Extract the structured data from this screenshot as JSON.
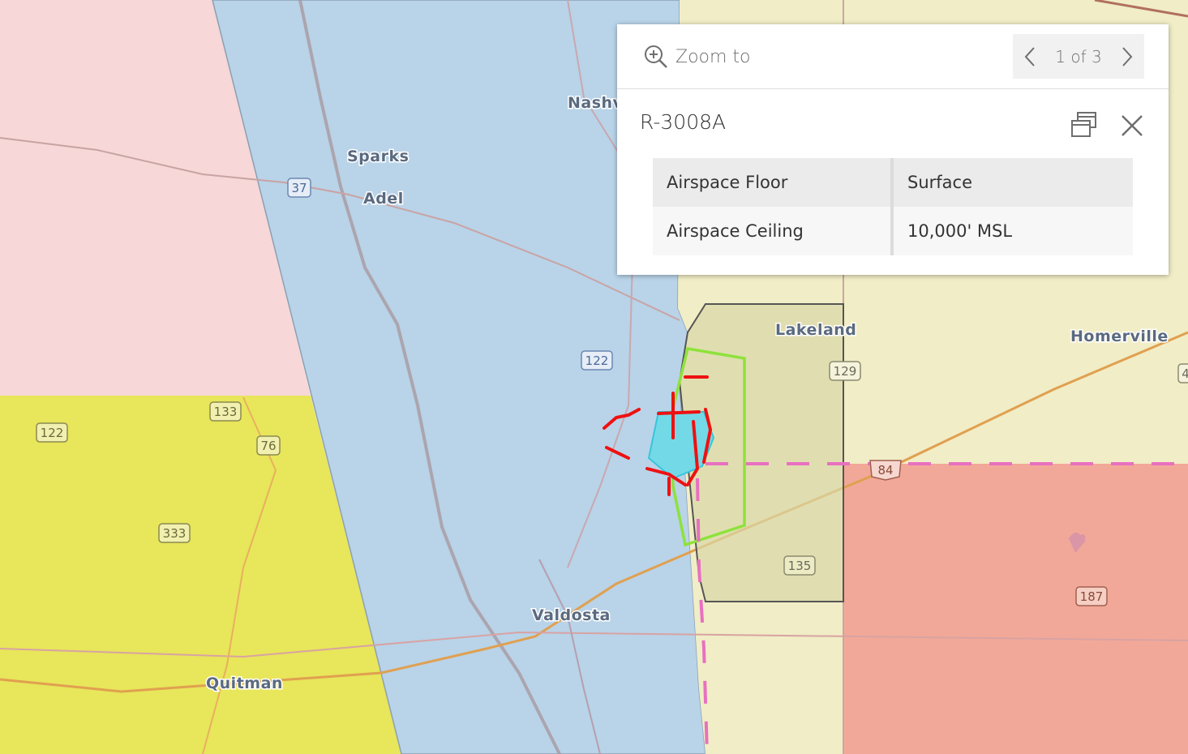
{
  "map": {
    "places": [
      {
        "id": "nashville",
        "label": "Nashv"
      },
      {
        "id": "sparks",
        "label": "Sparks"
      },
      {
        "id": "adel",
        "label": "Adel"
      },
      {
        "id": "lakeland",
        "label": "Lakeland"
      },
      {
        "id": "homerville",
        "label": "Homerville"
      },
      {
        "id": "valdosta",
        "label": "Valdosta"
      },
      {
        "id": "quitman",
        "label": "Quitman"
      }
    ],
    "shields": [
      {
        "id": "r37",
        "label": "37"
      },
      {
        "id": "r122a",
        "label": "122"
      },
      {
        "id": "r122b",
        "label": "122"
      },
      {
        "id": "r133",
        "label": "133"
      },
      {
        "id": "r76",
        "label": "76"
      },
      {
        "id": "r333",
        "label": "333"
      },
      {
        "id": "r129",
        "label": "129"
      },
      {
        "id": "r84",
        "label": "84"
      },
      {
        "id": "r135",
        "label": "135"
      },
      {
        "id": "r187",
        "label": "187"
      },
      {
        "id": "r4",
        "label": "4"
      }
    ],
    "colors": {
      "blue_zone": "#b9d3e8",
      "pink_zone": "#f7d7d7",
      "yellow_zone": "#e8e65a",
      "red_zone": "#f2a898",
      "tan_zone": "#f1edc6",
      "restricted_box": "#d9d7a6",
      "green_outline": "#8ee23c",
      "red_dash": "#ee1111",
      "cyan_fill": "#74d9e6",
      "magenta_dash": "#e870c0"
    }
  },
  "popup": {
    "zoom_label": "Zoom to",
    "pager": "1 of 3",
    "title": "R-3008A",
    "attributes": [
      {
        "key": "Airspace Floor",
        "value": "Surface"
      },
      {
        "key": "Airspace Ceiling",
        "value": "10,000' MSL"
      }
    ]
  }
}
